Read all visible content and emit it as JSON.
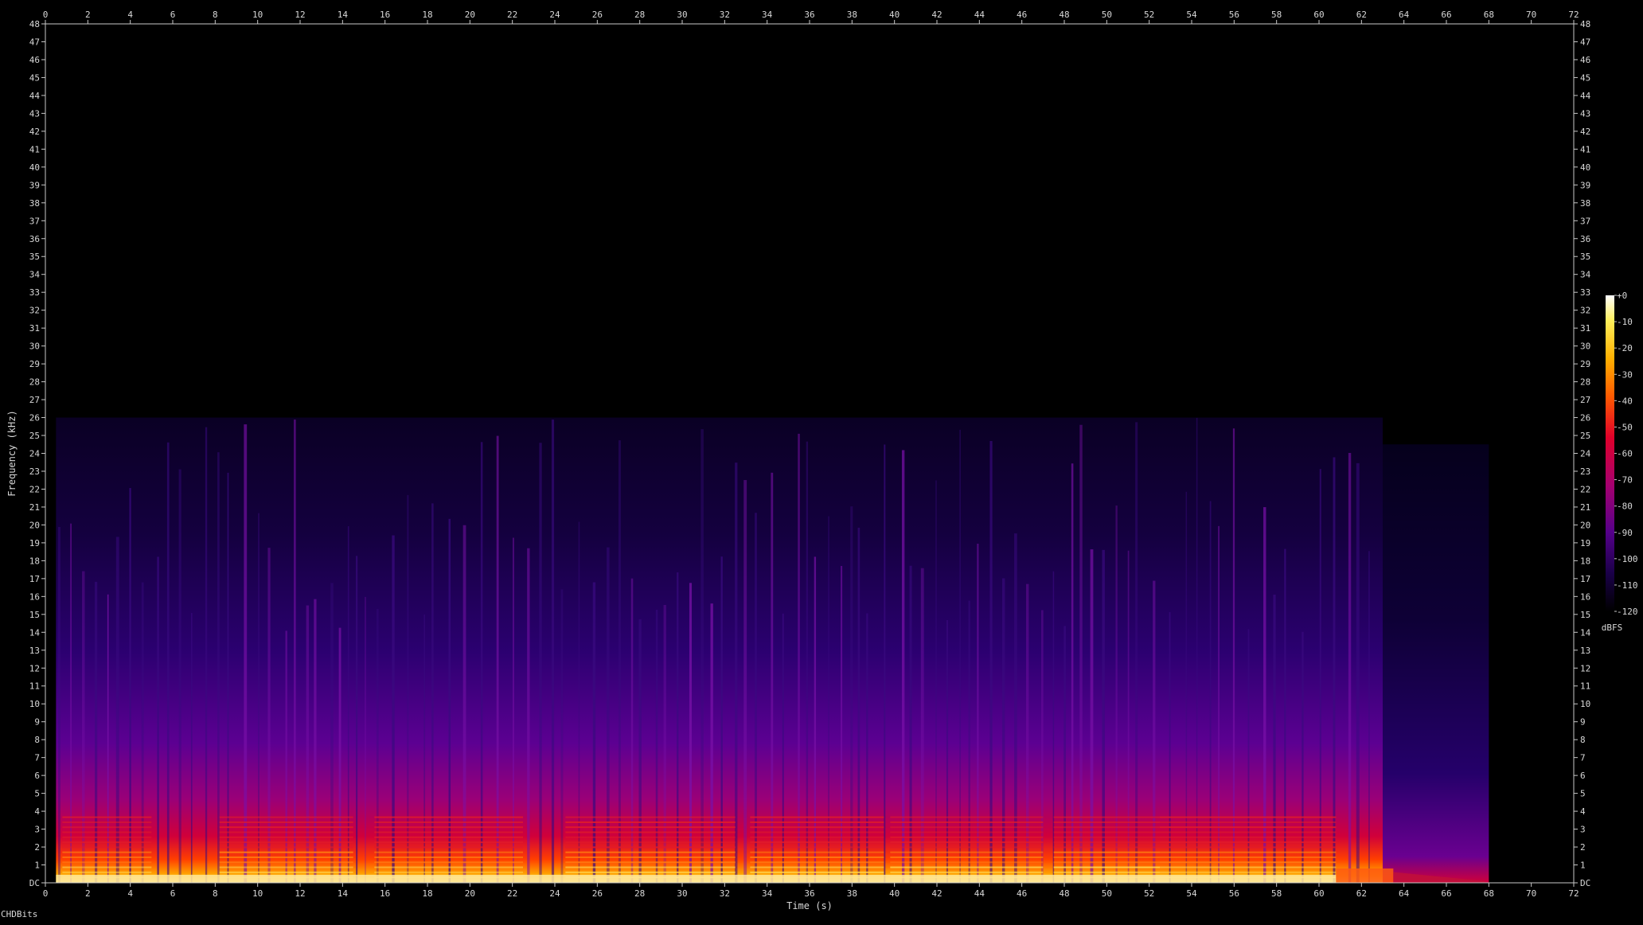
{
  "app": {
    "watermark": "CHDBits"
  },
  "chart_data": {
    "type": "heatmap",
    "title": "",
    "xlabel": "Time (s)",
    "ylabel": "Frequency (kHz)",
    "xlim": [
      0,
      72
    ],
    "ylim": [
      0,
      48
    ],
    "x_ticks": [
      "0",
      "2",
      "4",
      "6",
      "8",
      "10",
      "12",
      "14",
      "16",
      "18",
      "20",
      "22",
      "24",
      "26",
      "28",
      "30",
      "32",
      "34",
      "36",
      "38",
      "40",
      "42",
      "44",
      "46",
      "48",
      "50",
      "52",
      "54",
      "56",
      "58",
      "60",
      "62",
      "64",
      "66",
      "68",
      "70",
      "72"
    ],
    "y_ticks": [
      "DC",
      "1",
      "2",
      "3",
      "4",
      "5",
      "6",
      "7",
      "8",
      "9",
      "10",
      "11",
      "12",
      "13",
      "14",
      "15",
      "16",
      "17",
      "18",
      "19",
      "20",
      "21",
      "22",
      "23",
      "24",
      "25",
      "26",
      "27",
      "28",
      "29",
      "30",
      "31",
      "32",
      "33",
      "34",
      "35",
      "36",
      "37",
      "38",
      "39",
      "40",
      "41",
      "42",
      "43",
      "44",
      "45",
      "46",
      "47",
      "48"
    ],
    "content_extent": {
      "time_end_s": 68,
      "freq_cutoff_khz": 26,
      "loud_band_end_s": 63
    },
    "colorbar": {
      "label": "dBFS",
      "ticks": [
        "+0",
        "-10",
        "-20",
        "-30",
        "-40",
        "-50",
        "-60",
        "-70",
        "-80",
        "-90",
        "-100",
        "-110",
        "-120"
      ],
      "range_db": [
        -120,
        0
      ],
      "colormap": [
        "#000000",
        "#1a0048",
        "#55008a",
        "#a6006f",
        "#e0002a",
        "#ff5a00",
        "#ffb000",
        "#ffef5a",
        "#ffffff"
      ]
    },
    "grid": false
  }
}
